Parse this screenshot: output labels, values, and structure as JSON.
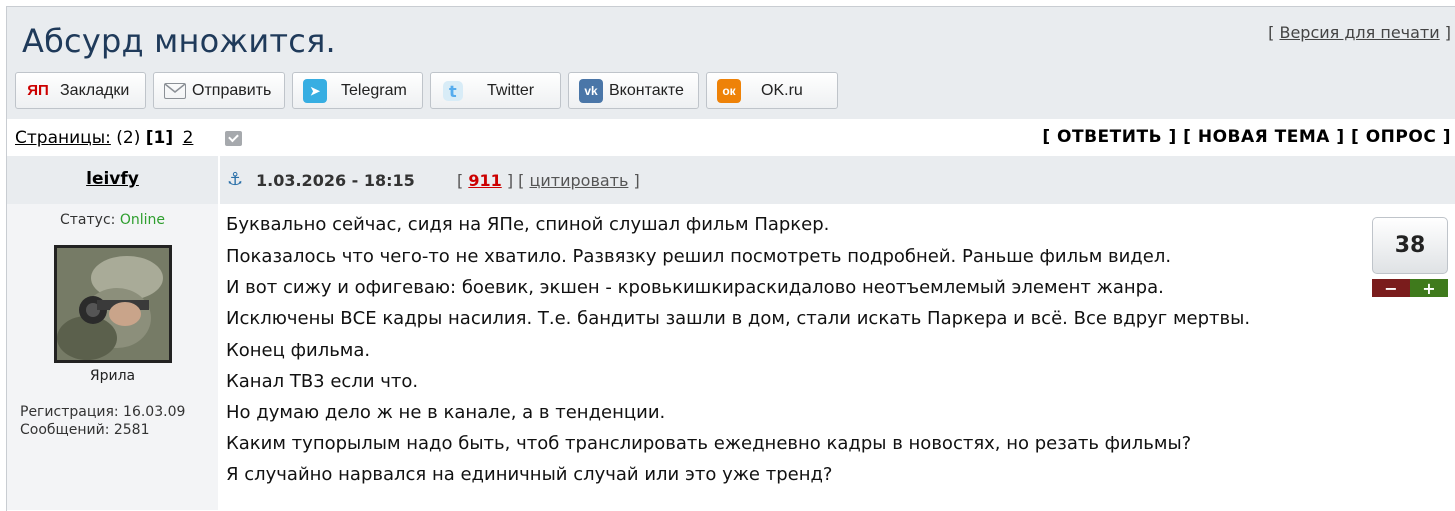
{
  "topic": {
    "title": "Абсурд множится.",
    "print_link": "Версия для печати",
    "print_bracket_open": "[",
    "print_bracket_close": "]"
  },
  "share": {
    "buttons": [
      {
        "label": "Закладки",
        "icon": "yap-bookmarks-icon",
        "glyph": "ЯП"
      },
      {
        "label": "Отправить",
        "icon": "mail-icon",
        "glyph": ""
      },
      {
        "label": "Telegram",
        "icon": "telegram-icon",
        "glyph": "➤"
      },
      {
        "label": "Twitter",
        "icon": "twitter-icon",
        "glyph": "t"
      },
      {
        "label": "Вконтакте",
        "icon": "vk-icon",
        "glyph": "vk"
      },
      {
        "label": "OK.ru",
        "icon": "ok-icon",
        "glyph": "ок"
      }
    ]
  },
  "pagination": {
    "label": "Страницы:",
    "count": "(2)",
    "current": "[1]",
    "next": "2"
  },
  "actions": {
    "reply": "[ ОТВЕТИТЬ ]",
    "new_topic": "[ НОВАЯ ТЕМА ]",
    "poll": "[ ОПРОС ]"
  },
  "post": {
    "author": "leivfy",
    "date": "1.03.2026 - 18:15",
    "number": "911",
    "quote_label": "цитировать",
    "rating": "38",
    "lines": [
      "Буквально сейчас, сидя на ЯПе, спиной слушал фильм Паркер.",
      "Показалось что чего-то не хватило. Развязку решил посмотреть подробней. Раньше фильм видел.",
      "И вот сижу и офигеваю: боевик, экшен - кровькишкираскидалово неотъемлемый элемент жанра.",
      "Исключены ВСЕ кадры насилия. Т.е. бандиты зашли в дом, стали искать Паркера и всё. Все вдруг мертвы.",
      "Конец фильма.",
      "Канал ТВ3 если что.",
      "Но думаю дело ж не в канале, а в тенденции.",
      "Каким тупорылым надо быть, чтоб транслировать ежедневно кадры в новостях, но резать фильмы?",
      "Я случайно нарвался на единичный случай или это уже тренд?"
    ]
  },
  "user": {
    "status_label": "Статус:",
    "status_value": "Online",
    "rank": "Ярила",
    "registration": "Регистрация: 16.03.09",
    "messages": "Сообщений: 2581"
  },
  "colors": {
    "title": "#1f3a5a",
    "header_bg": "#e9ecef",
    "online": "#2e9e2e",
    "post_number": "#cc0000",
    "minus": "#7a1c1c",
    "plus": "#3f7a1c"
  }
}
